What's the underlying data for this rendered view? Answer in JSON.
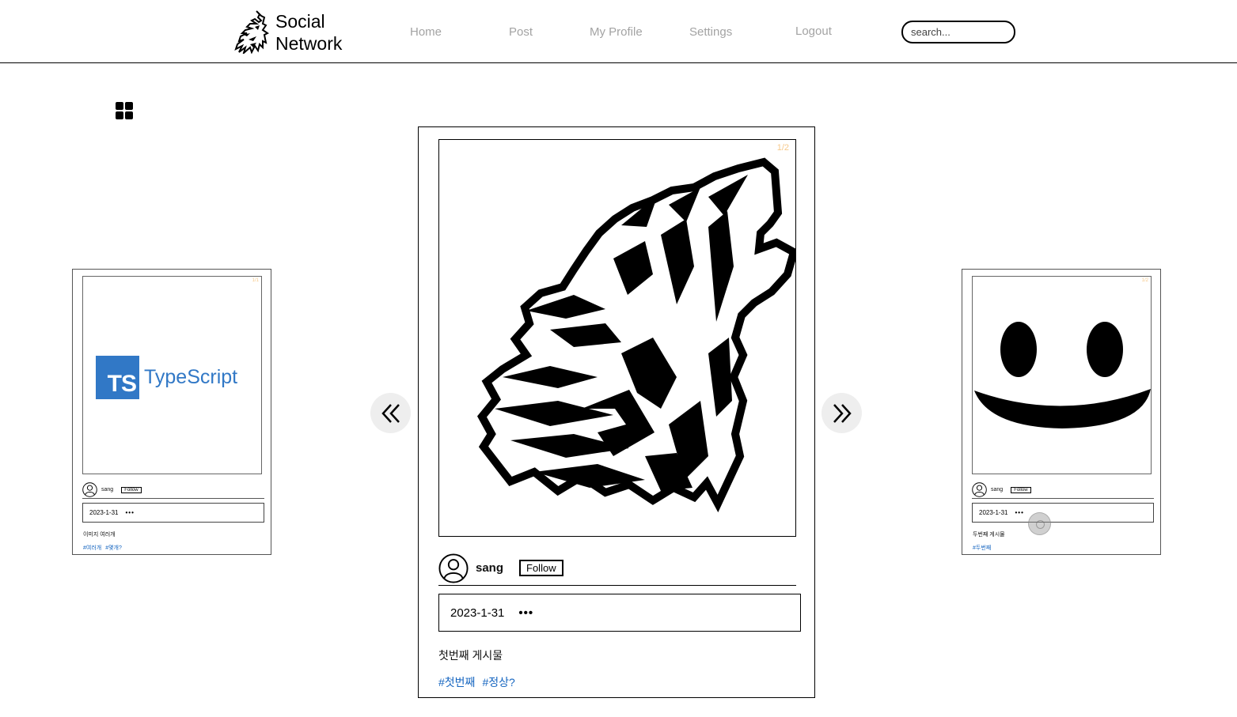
{
  "header": {
    "brand_line1": "Social",
    "brand_line2": "Network",
    "nav": {
      "home": "Home",
      "post": "Post",
      "my_profile": "My Profile",
      "settings": "Settings",
      "logout": "Logout"
    },
    "search_placeholder": "search..."
  },
  "view_toggle_icon": "grid-icon",
  "carousel": {
    "prev_icon": "double-chevron-left-icon",
    "next_icon": "double-chevron-right-icon",
    "current": {
      "counter": "1/2",
      "image": "howling-wolf-illustration",
      "author": "sang",
      "follow_label": "Follow",
      "date": "2023-1-31",
      "more": "•••",
      "caption": "첫번째 게시물",
      "tags": [
        "#첫번째",
        "#정상?"
      ]
    },
    "previous": {
      "counter": "1/1",
      "image_word": "TypeScript",
      "image_badge": "TS",
      "author": "sang",
      "follow_label": "Follow",
      "date": "2023-1-31",
      "more": "•••",
      "caption": "이미지 여러개",
      "tags": [
        "#여러개",
        "#몇개?"
      ]
    },
    "next": {
      "counter": "1/2",
      "image": "smiley-face",
      "author": "sang",
      "follow_label": "Follow",
      "date": "2023-1-31",
      "more": "•••",
      "caption": "두번째 게시물",
      "tags": [
        "#두번째"
      ]
    }
  },
  "colors": {
    "nav_text": "#a3a3a3",
    "tag": "#1565c0",
    "counter": "#f6c88a",
    "typescript": "#3178c6",
    "arrow_bg": "#eeeeee"
  }
}
